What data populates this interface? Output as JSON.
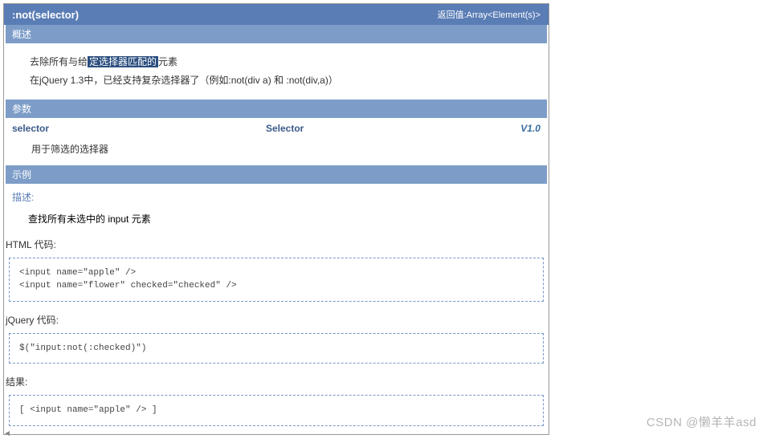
{
  "header": {
    "title": ":not(selector)",
    "return_label": "返回值:Array<Element(s)>"
  },
  "sections": {
    "overview_title": "概述",
    "overview_line1_prefix": "去除所有与给",
    "overview_line1_highlight": "定选择器匹配的",
    "overview_line1_suffix": "元素",
    "overview_line2": "在jQuery 1.3中，已经支持复杂选择器了（例如:not(div a) 和 :not(div,a)）",
    "params_title": "参数",
    "param_name": "selector",
    "param_type": "Selector",
    "param_version": "V1.0",
    "param_desc": "用于筛选的选择器",
    "example_title": "示例",
    "example_subheader": "描述:",
    "example_desc": "查找所有未选中的 input 元素",
    "html_label": "HTML 代码:",
    "html_code": "<input name=\"apple\" />\n<input name=\"flower\" checked=\"checked\" />",
    "jquery_label": "jQuery 代码:",
    "jquery_code": "$(\"input:not(:checked)\")",
    "result_label": "结果:",
    "result_code": "[ <input name=\"apple\" /> ]"
  },
  "watermark": "CSDN @懒羊羊asd"
}
